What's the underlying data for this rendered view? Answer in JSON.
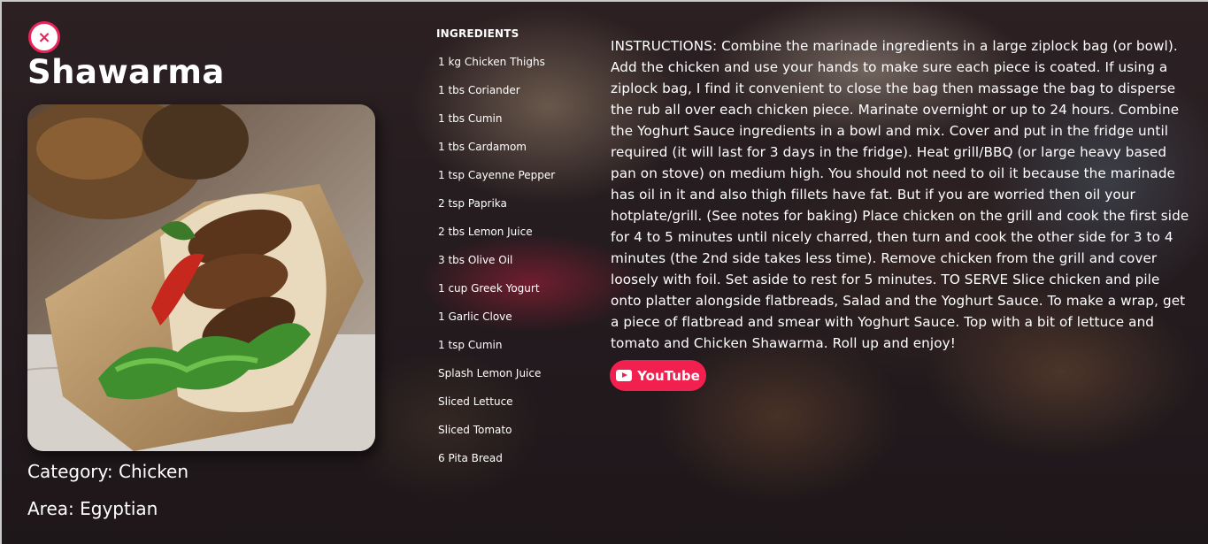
{
  "meal": {
    "title": "Shawarma",
    "category": "Category: Chicken",
    "area": "Area: Egyptian",
    "image_alt": "Shawarma wrap photo"
  },
  "close_button": {
    "label": "×",
    "icon": "close-icon",
    "color": "#e8245a"
  },
  "ingredients": {
    "header": "INGREDIENTS",
    "items": [
      "1 kg Chicken Thighs",
      "1 tbs Coriander",
      "1 tbs Cumin",
      "1 tbs Cardamom",
      "1 tsp Cayenne Pepper",
      "2 tsp Paprika",
      "2 tbs Lemon Juice",
      "3 tbs Olive Oil",
      "1 cup Greek Yogurt",
      "1 Garlic Clove",
      "1 tsp Cumin",
      "Splash Lemon Juice",
      "Sliced Lettuce",
      "Sliced Tomato",
      "6 Pita Bread"
    ]
  },
  "instructions": "INSTRUCTIONS: Combine the marinade ingredients in a large ziplock bag (or bowl). Add the chicken and use your hands to make sure each piece is coated. If using a ziplock bag, I find it convenient to close the bag then massage the bag to disperse the rub all over each chicken piece. Marinate overnight or up to 24 hours. Combine the Yoghurt Sauce ingredients in a bowl and mix. Cover and put in the fridge until required (it will last for 3 days in the fridge). Heat grill/BBQ (or large heavy based pan on stove) on medium high. You should not need to oil it because the marinade has oil in it and also thigh fillets have fat. But if you are worried then oil your hotplate/grill. (See notes for baking) Place chicken on the grill and cook the first side for 4 to 5 minutes until nicely charred, then turn and cook the other side for 3 to 4 minutes (the 2nd side takes less time). Remove chicken from the grill and cover loosely with foil. Set aside to rest for 5 minutes. TO SERVE Slice chicken and pile onto platter alongside flatbreads, Salad and the Yoghurt Sauce. To make a wrap, get a piece of flatbread and smear with Yoghurt Sauce. Top with a bit of lettuce and tomato and Chicken Shawarma. Roll up and enjoy!",
  "youtube_button": {
    "label": "YouTube",
    "icon": "youtube-icon",
    "color": "#f2204f"
  }
}
